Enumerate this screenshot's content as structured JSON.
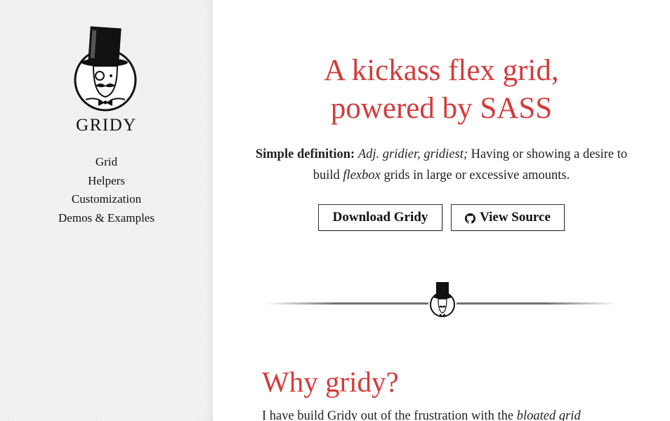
{
  "sidebar": {
    "brand": "GRIDY",
    "logo_icon": "top-hat-gentleman-logo",
    "nav": [
      {
        "label": "Grid"
      },
      {
        "label": "Helpers"
      },
      {
        "label": "Customization"
      },
      {
        "label": "Demos & Examples"
      }
    ]
  },
  "hero": {
    "title_line1": "A kickass flex grid,",
    "title_line2": "powered by SASS",
    "definition": {
      "label": "Simple definition:",
      "pos": "Adj. gridier, gridiest;",
      "text_before": " Having or showing a desire to build ",
      "emphasis": "flexbox",
      "text_after": " grids in large or excessive amounts."
    }
  },
  "buttons": {
    "download": "Download Gridy",
    "source": "View Source",
    "source_icon": "github-icon"
  },
  "section": {
    "heading": "Why gridy?",
    "text_start": "I have build Gridy out of the frustration with the ",
    "text_emphasis": "bloated grid"
  },
  "colors": {
    "accent": "#d23c3c",
    "text": "#222222",
    "sidebar_bg": "#f3f3f3"
  }
}
